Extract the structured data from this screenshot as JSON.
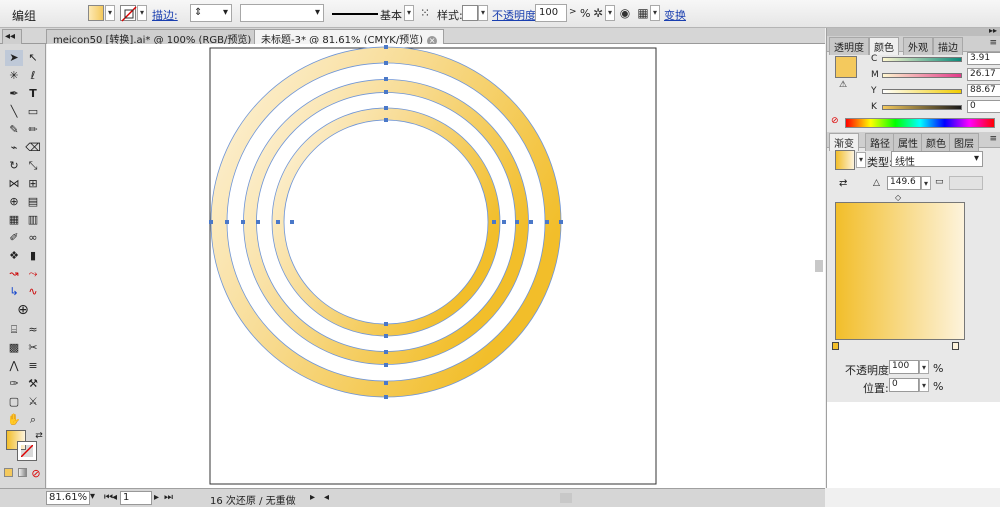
{
  "control_bar": {
    "mode_label": "编组",
    "stroke_label": "描边:",
    "stroke_preset": "基本",
    "style_label": "样式:",
    "opacity_label": "不透明度:",
    "opacity_value": "100",
    "opacity_unit": ">",
    "opacity_pct": "%",
    "transform_label": "变换",
    "fill_color": "#f4c95d"
  },
  "tabs": [
    {
      "label": "meicon50 [转换].ai* @ 100% (RGB/预览)"
    },
    {
      "label": "未标题-3* @ 81.61% (CMYK/预览)"
    }
  ],
  "color_panel": {
    "tabs": [
      "透明度",
      "颜色",
      "外观",
      "描边"
    ],
    "channels": [
      {
        "key": "C",
        "value": "3.91",
        "pct": "%"
      },
      {
        "key": "M",
        "value": "26.17",
        "pct": "%"
      },
      {
        "key": "Y",
        "value": "88.67",
        "pct": "%"
      },
      {
        "key": "K",
        "value": "0",
        "pct": "%"
      }
    ]
  },
  "gradient_panel": {
    "tabs": [
      "渐变",
      "路径",
      "属性",
      "颜色",
      "图层"
    ],
    "type_label": "类型:",
    "type_value": "线性",
    "angle_value": "149.6",
    "opacity_label": "不透明度:",
    "opacity_value": "100",
    "opacity_pct": "%",
    "position_label": "位置:",
    "position_value": "0",
    "position_pct": "%",
    "stop_start": "#f2be2a",
    "stop_end": "#fdf3dc"
  },
  "status": {
    "zoom": "81.61%",
    "page": "1",
    "message": "16 次还原 / 无重做"
  }
}
